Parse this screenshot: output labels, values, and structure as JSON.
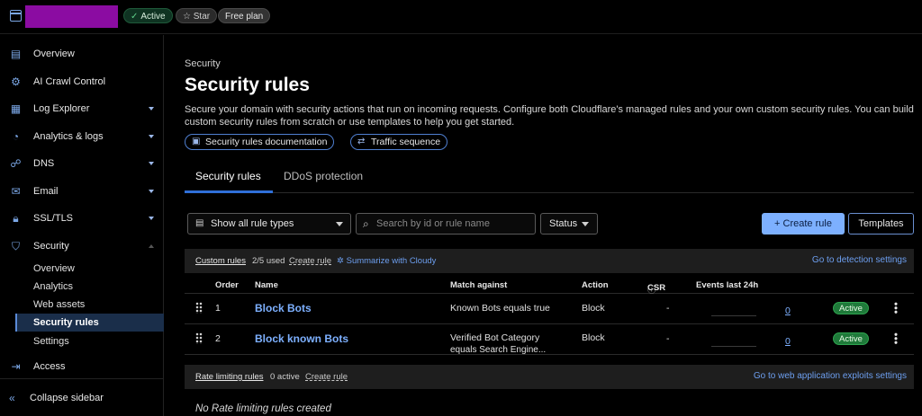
{
  "topbar": {
    "badges": {
      "active": "Active",
      "star": "Star",
      "plan": "Free plan"
    }
  },
  "sidebar": {
    "items": [
      {
        "label": "Overview",
        "icon": "document-icon"
      },
      {
        "label": "AI Crawl Control",
        "icon": "robot-icon"
      },
      {
        "label": "Log Explorer",
        "icon": "log-icon"
      },
      {
        "label": "Analytics & logs",
        "icon": "chart-icon"
      },
      {
        "label": "DNS",
        "icon": "dns-icon"
      },
      {
        "label": "Email",
        "icon": "email-icon"
      },
      {
        "label": "SSL/TLS",
        "icon": "lock-icon"
      },
      {
        "label": "Security",
        "icon": "shield-icon"
      }
    ],
    "security_sub": [
      "Overview",
      "Analytics",
      "Web assets",
      "Security rules",
      "Settings"
    ],
    "access": "Access",
    "collapse": "Collapse sidebar"
  },
  "page": {
    "breadcrumb": "Security",
    "title": "Security rules",
    "description": "Secure your domain with security actions that run on incoming requests. Configure both Cloudflare's managed rules and your own custom security rules. You can build custom security rules from scratch or use templates to help you get started.",
    "doc_link": "Security rules documentation",
    "traffic_link": "Traffic sequence"
  },
  "tabs": [
    "Security rules",
    "DDoS protection"
  ],
  "filters": {
    "rule_type": "Show all rule types",
    "search_placeholder": "Search by id or rule name",
    "status": "Status",
    "create_rule": "+ Create rule",
    "templates": "Templates"
  },
  "custom_rules": {
    "title": "Custom rules",
    "used": "2/5 used",
    "create": "Create rule",
    "cloudy": "Summarize with Cloudy",
    "settings_link": "Go to detection settings",
    "columns": [
      "Order",
      "Name",
      "Match against",
      "Action",
      "CSR",
      "Events last 24h"
    ],
    "rows": [
      {
        "order": "1",
        "name": "Block Bots",
        "match1": "Known Bots equals true",
        "match2": "",
        "action": "Block",
        "csr": "-",
        "events": "0",
        "status": "Active"
      },
      {
        "order": "2",
        "name": "Block known Bots",
        "match1": "Verified Bot Category",
        "match2": "equals Search Engine...",
        "action": "Block",
        "csr": "-",
        "events": "0",
        "status": "Active"
      }
    ]
  },
  "rate_rules": {
    "title": "Rate limiting rules",
    "active": "0 active",
    "create": "Create rule",
    "settings_link": "Go to web application exploits settings",
    "empty": "No Rate limiting rules created"
  }
}
